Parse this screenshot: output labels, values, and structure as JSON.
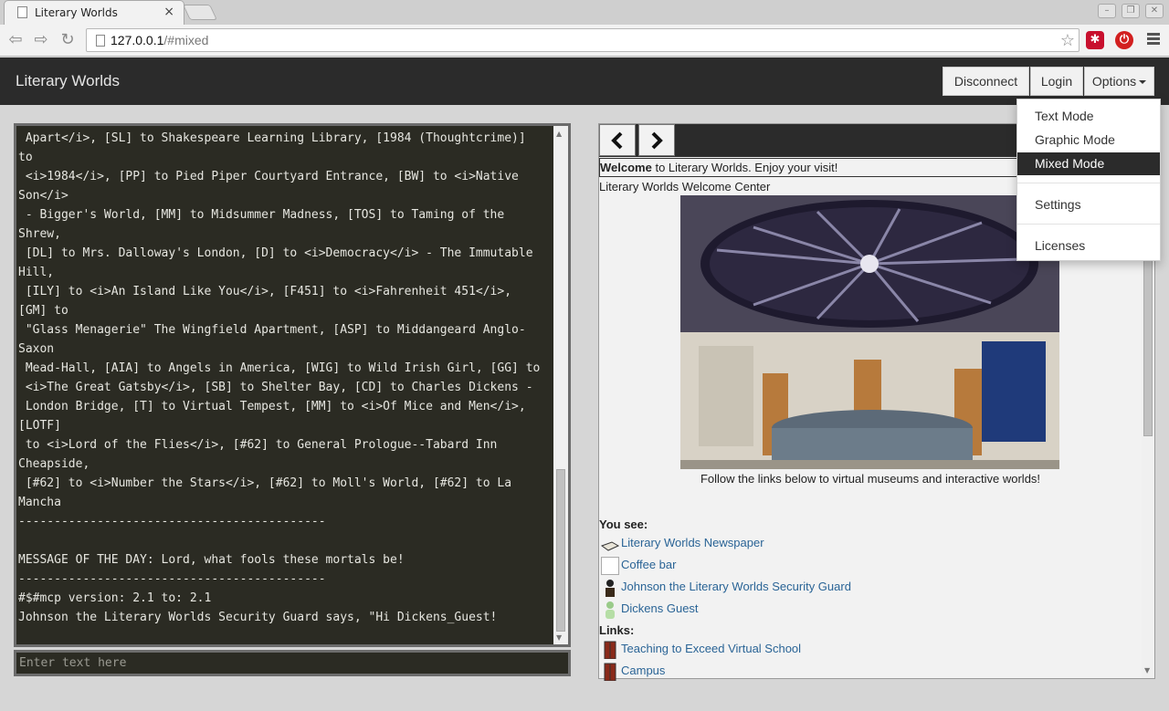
{
  "browser": {
    "tab_title": "Literary Worlds",
    "tab_close": "×",
    "url_host": "127.0.0.1",
    "url_path": "/#mixed"
  },
  "navbar": {
    "brand": "Literary Worlds",
    "disconnect": "Disconnect",
    "login": "Login",
    "options": "Options"
  },
  "options_menu": {
    "items": [
      "Text Mode",
      "Graphic Mode",
      "Mixed Mode",
      "Settings",
      "Licenses"
    ],
    "active": "Mixed Mode"
  },
  "console": {
    "lines": [
      " Apart</i>, [SL] to Shakespeare Learning Library, [1984 (Thoughtcrime)]",
      "to",
      " <i>1984</i>, [PP] to Pied Piper Courtyard Entrance, [BW] to <i>Native",
      "Son</i>",
      " - Bigger's World, [MM] to Midsummer Madness, [TOS] to Taming of the",
      "Shrew,",
      " [DL] to Mrs. Dalloway's London, [D] to <i>Democracy</i> - The Immutable",
      "Hill,",
      " [ILY] to <i>An Island Like You</i>, [F451] to <i>Fahrenheit 451</i>,",
      "[GM] to",
      " \"Glass Menagerie\" The Wingfield Apartment, [ASP] to Middangeard Anglo-",
      "Saxon",
      " Mead-Hall, [AIA] to Angels in America, [WIG] to Wild Irish Girl, [GG] to",
      " <i>The Great Gatsby</i>, [SB] to Shelter Bay, [CD] to Charles Dickens -",
      " London Bridge, [T] to Virtual Tempest, [MM] to <i>Of Mice and Men</i>,",
      "[LOTF]",
      " to <i>Lord of the Flies</i>, [#62] to General Prologue--Tabard Inn",
      "Cheapside,",
      " [#62] to <i>Number the Stars</i>, [#62] to Moll's World, [#62] to La",
      "Mancha",
      "-------------------------------------------",
      "",
      "MESSAGE OF THE DAY: Lord, what fools these mortals be!",
      "-------------------------------------------",
      "#$#mcp version: 2.1 to: 2.1",
      "Johnson the Literary Worlds Security Guard says, \"Hi Dickens_Guest!"
    ],
    "input_placeholder": "Enter text here"
  },
  "room": {
    "welcome_bold": "Welcome",
    "welcome_rest": " to Literary Worlds. Enjoy your visit!",
    "title": "Literary Worlds Welcome Center",
    "caption": "Follow the links below to virtual museums and interactive worlds!",
    "you_see_label": "You see:",
    "you_see": [
      "Literary Worlds Newspaper",
      "Coffee bar",
      "Johnson the Literary Worlds Security Guard",
      "Dickens Guest"
    ],
    "links_label": "Links:",
    "links": [
      "Teaching to Exceed Virtual School",
      "Campus"
    ]
  },
  "colors": {
    "navbar": "#2b2b2b",
    "console_bg": "#2b2b23",
    "link": "#2a6496"
  }
}
